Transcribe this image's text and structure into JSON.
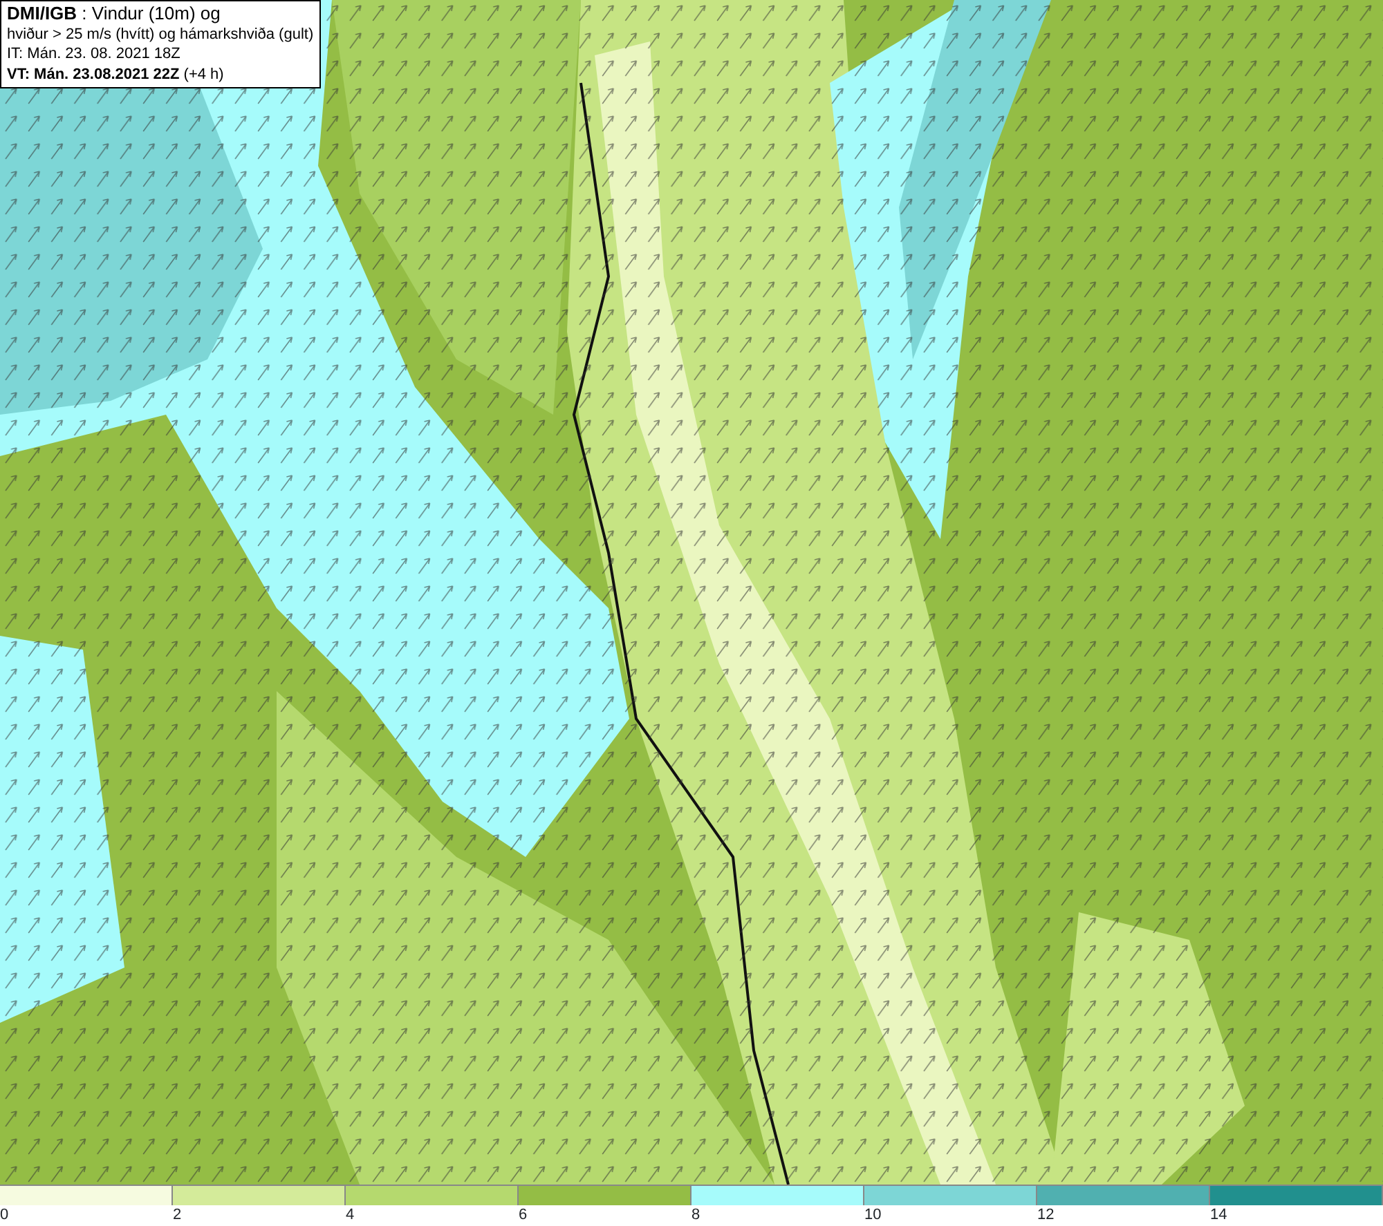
{
  "header": {
    "lines": [
      "**DMI/IGB** : Vindur (10m) og",
      "hviður > 25 m/s (hvítt) og hámarkshviða (gult)",
      "IT: Mán. 23. 08. 2021 18Z",
      "**VT: Mán. 23.08.2021 22Z** (+4 h)"
    ]
  },
  "legend": {
    "bins": [
      {
        "color": "#f6fbe0"
      },
      {
        "color": "#d4eb9a"
      },
      {
        "color": "#b5d96e"
      },
      {
        "color": "#94bd45"
      },
      {
        "color": "#a6fbfb"
      },
      {
        "color": "#7dd6d6"
      },
      {
        "color": "#50b0b0"
      },
      {
        "color": "#21908e"
      }
    ],
    "ticks": [
      "0",
      "2",
      "4",
      "6",
      "8",
      "10",
      "12",
      "14"
    ]
  }
}
